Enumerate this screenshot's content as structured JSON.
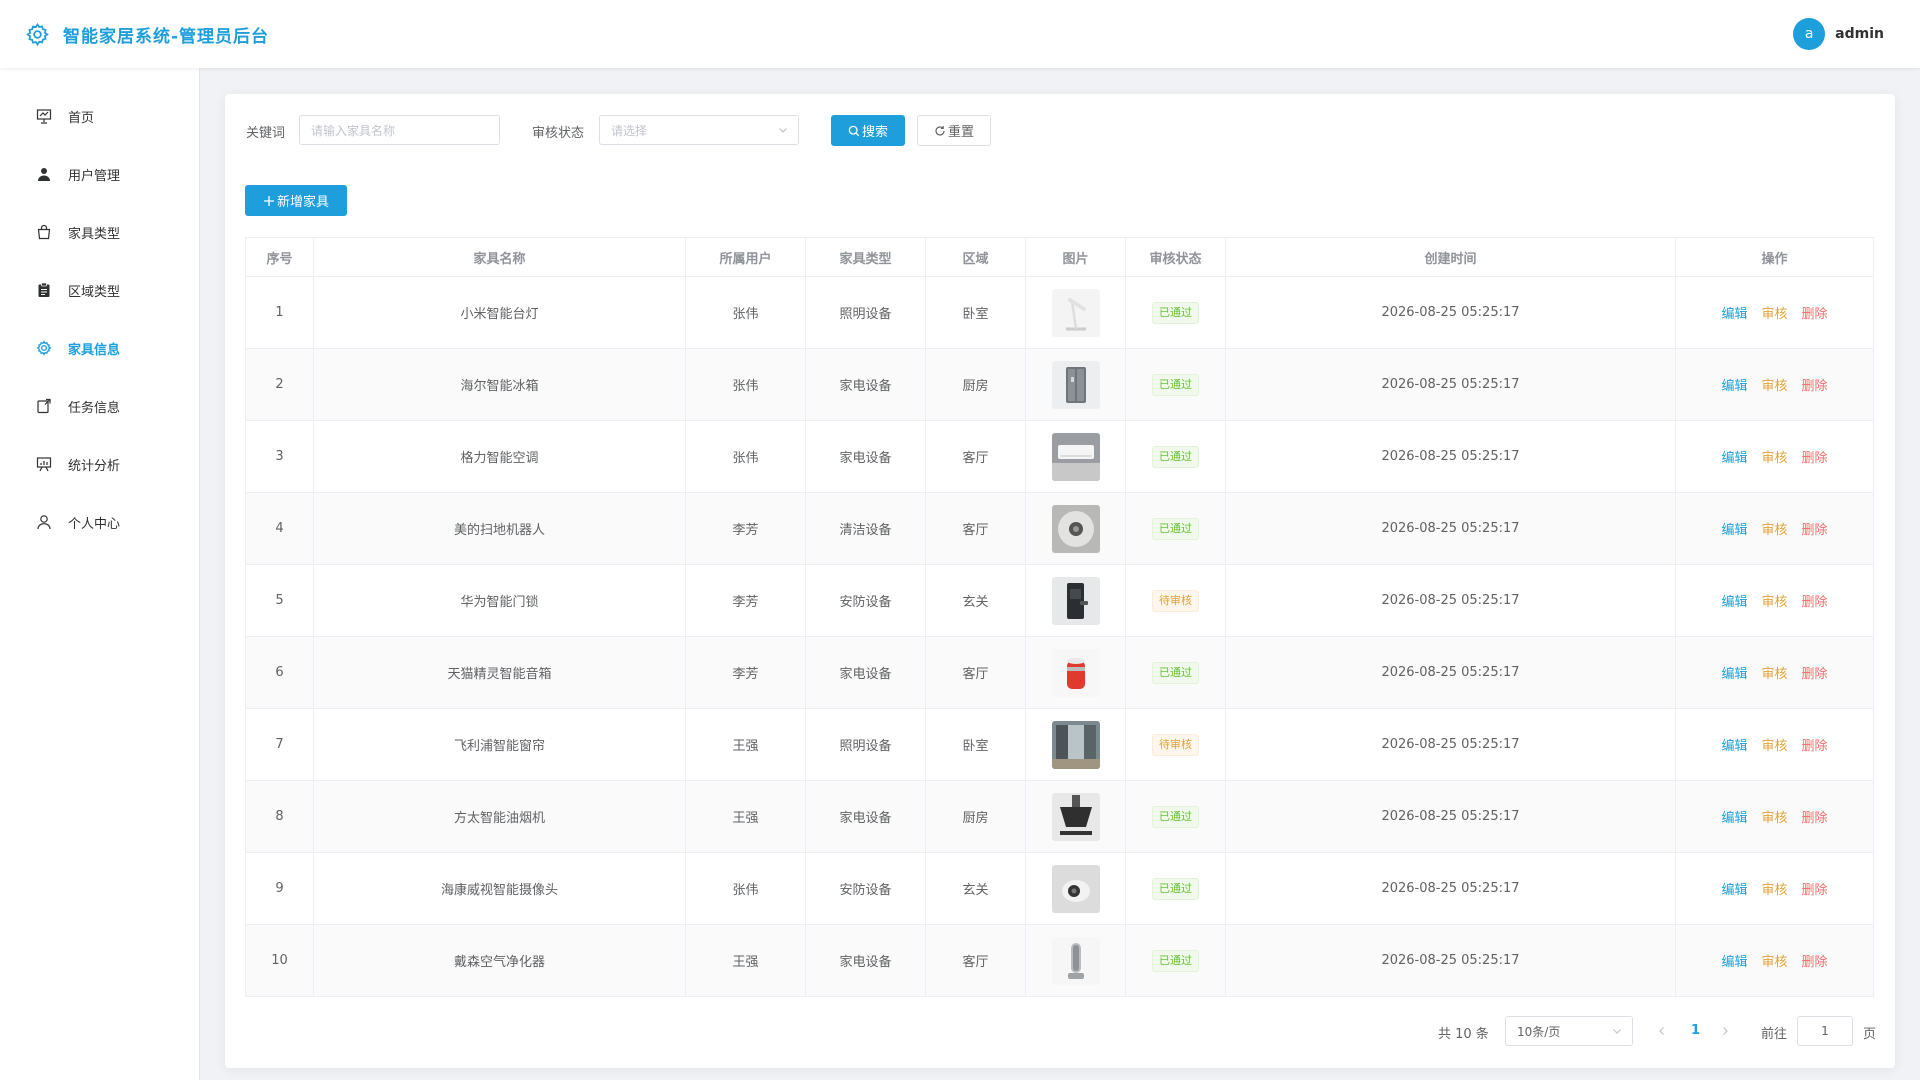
{
  "app": {
    "title": "智能家居系统-管理员后台",
    "user_initial": "a",
    "username": "admin"
  },
  "sidebar": {
    "items": [
      {
        "label": "首页",
        "icon": "home-presentation-icon",
        "active": false
      },
      {
        "label": "用户管理",
        "icon": "user-icon",
        "active": false
      },
      {
        "label": "家具类型",
        "icon": "bag-icon",
        "active": false
      },
      {
        "label": "区域类型",
        "icon": "clipboard-icon",
        "active": false
      },
      {
        "label": "家具信息",
        "icon": "gear-icon",
        "active": true
      },
      {
        "label": "任务信息",
        "icon": "task-icon",
        "active": false
      },
      {
        "label": "统计分析",
        "icon": "chart-board-icon",
        "active": false
      },
      {
        "label": "个人中心",
        "icon": "person-icon",
        "active": false
      }
    ]
  },
  "filters": {
    "keyword_label": "关键词",
    "keyword_placeholder": "请输入家具名称",
    "status_label": "审核状态",
    "status_placeholder": "请选择",
    "search_label": "搜索",
    "reset_label": "重置"
  },
  "add_button_label": "新增家具",
  "table": {
    "headers": [
      "序号",
      "家具名称",
      "所属用户",
      "家具类型",
      "区域",
      "图片",
      "审核状态",
      "创建时间",
      "操作"
    ],
    "actions": {
      "edit": "编辑",
      "audit": "审核",
      "delete": "删除"
    },
    "rows": [
      {
        "no": "1",
        "name": "小米智能台灯",
        "user": "张伟",
        "type": "照明设备",
        "area": "卧室",
        "image": "desk-lamp",
        "status": "已通过",
        "status_kind": "ok",
        "created": "2026-08-25 05:25:17"
      },
      {
        "no": "2",
        "name": "海尔智能冰箱",
        "user": "张伟",
        "type": "家电设备",
        "area": "厨房",
        "image": "fridge",
        "status": "已通过",
        "status_kind": "ok",
        "created": "2026-08-25 05:25:17"
      },
      {
        "no": "3",
        "name": "格力智能空调",
        "user": "张伟",
        "type": "家电设备",
        "area": "客厅",
        "image": "air-conditioner",
        "status": "已通过",
        "status_kind": "ok",
        "created": "2026-08-25 05:25:17"
      },
      {
        "no": "4",
        "name": "美的扫地机器人",
        "user": "李芳",
        "type": "清洁设备",
        "area": "客厅",
        "image": "robot-vacuum",
        "status": "已通过",
        "status_kind": "ok",
        "created": "2026-08-25 05:25:17"
      },
      {
        "no": "5",
        "name": "华为智能门锁",
        "user": "李芳",
        "type": "安防设备",
        "area": "玄关",
        "image": "door-lock",
        "status": "待审核",
        "status_kind": "wait",
        "created": "2026-08-25 05:25:17"
      },
      {
        "no": "6",
        "name": "天猫精灵智能音箱",
        "user": "李芳",
        "type": "家电设备",
        "area": "客厅",
        "image": "smart-speaker",
        "status": "已通过",
        "status_kind": "ok",
        "created": "2026-08-25 05:25:17"
      },
      {
        "no": "7",
        "name": "飞利浦智能窗帘",
        "user": "王强",
        "type": "照明设备",
        "area": "卧室",
        "image": "curtain",
        "status": "待审核",
        "status_kind": "wait",
        "created": "2026-08-25 05:25:17"
      },
      {
        "no": "8",
        "name": "方太智能油烟机",
        "user": "王强",
        "type": "家电设备",
        "area": "厨房",
        "image": "range-hood",
        "status": "已通过",
        "status_kind": "ok",
        "created": "2026-08-25 05:25:17"
      },
      {
        "no": "9",
        "name": "海康威视智能摄像头",
        "user": "张伟",
        "type": "安防设备",
        "area": "玄关",
        "image": "camera",
        "status": "已通过",
        "status_kind": "ok",
        "created": "2026-08-25 05:25:17"
      },
      {
        "no": "10",
        "name": "戴森空气净化器",
        "user": "王强",
        "type": "家电设备",
        "area": "客厅",
        "image": "air-purifier",
        "status": "已通过",
        "status_kind": "ok",
        "created": "2026-08-25 05:25:17"
      }
    ]
  },
  "pagination": {
    "total": "共 10 条",
    "page_size": "10条/页",
    "current": "1",
    "goto_label": "前往",
    "goto_value": "1",
    "page_suffix": "页"
  },
  "colors": {
    "primary": "#1e9fdc",
    "success": "#67c23a",
    "warning": "#e6a23c",
    "danger": "#f56c6c"
  }
}
